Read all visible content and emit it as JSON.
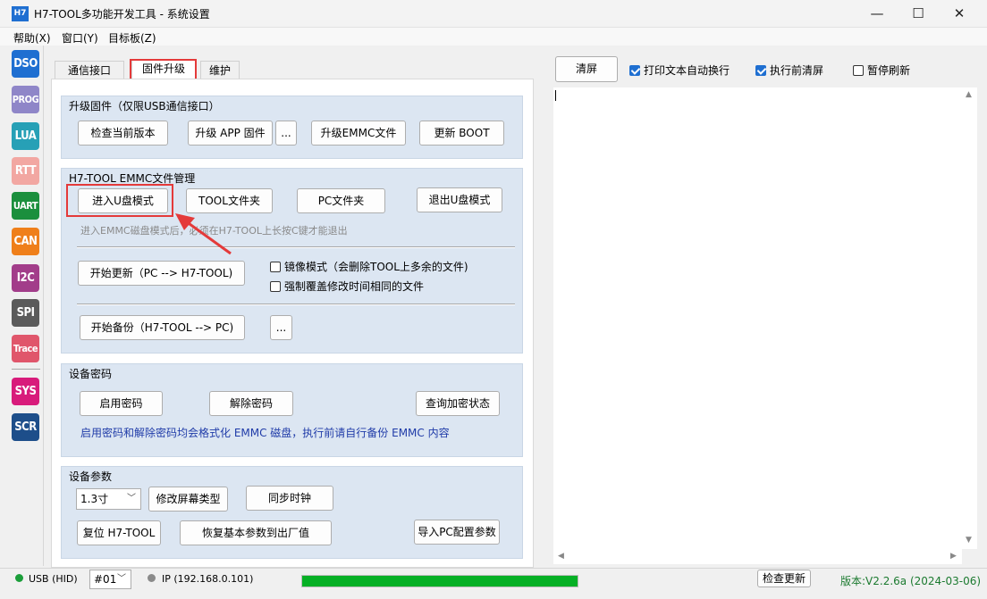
{
  "window": {
    "app_icon": "H7",
    "title": "H7-TOOL多功能开发工具 - 系统设置",
    "minimize": "—",
    "maximize": "☐",
    "close": "✕"
  },
  "menu": [
    "帮助(X)",
    "窗口(Y)",
    "目标板(Z)"
  ],
  "tools": [
    {
      "label": "DSO",
      "color": "#1f6fd1"
    },
    {
      "label": "PROG",
      "color": "#8f86c8"
    },
    {
      "label": "LUA",
      "color": "#27a0b6"
    },
    {
      "label": "RTT",
      "color": "#f2a7a2"
    },
    {
      "label": "UART",
      "color": "#1b8f3d"
    },
    {
      "label": "CAN",
      "color": "#ef7f1a"
    },
    {
      "label": "I2C",
      "color": "#a23d8a"
    },
    {
      "label": "SPI",
      "color": "#5b5b5b"
    },
    {
      "label": "Trace",
      "color": "#e0566b"
    },
    {
      "label": "SYS",
      "color": "#d81b7b"
    },
    {
      "label": "SCR",
      "color": "#1d4e8a"
    }
  ],
  "tabs": [
    "通信接口",
    "固件升级",
    "维护"
  ],
  "firmware": {
    "title": "升级固件（仅限USB通信接口）",
    "check_version": "检查当前版本",
    "upgrade_app": "升级 APP 固件",
    "more": "...",
    "upgrade_emmc": "升级EMMC文件",
    "update_boot": "更新 BOOT"
  },
  "emmc": {
    "title": "H7-TOOL EMMC文件管理",
    "enter_udisk": "进入U盘模式",
    "tool_folder": "TOOL文件夹",
    "pc_folder": "PC文件夹",
    "exit_udisk": "退出U盘模式",
    "hint": "进入EMMC磁盘模式后，必须在H7-TOOL上长按C键才能退出",
    "start_update": "开始更新（PC --> H7-TOOL)",
    "mirror_mode": "镜像模式（会删除TOOL上多余的文件)",
    "force_overwrite": "强制覆盖修改时间相同的文件",
    "start_backup": "开始备份（H7-TOOL --> PC)",
    "more": "..."
  },
  "password": {
    "title": "设备密码",
    "enable": "启用密码",
    "disable": "解除密码",
    "query": "查询加密状态",
    "note": "启用密码和解除密码均会格式化 EMMC 磁盘，执行前请自行备份 EMMC 内容"
  },
  "params": {
    "title": "设备参数",
    "screen_size": "1.3寸",
    "change_screen": "修改屏幕类型",
    "sync_clock": "同步时钟",
    "reset": "复位 H7-TOOL",
    "restore": "恢复基本参数到出厂值",
    "import_pc": "导入PC配置参数"
  },
  "right": {
    "clear": "清屏",
    "auto_wrap": "打印文本自动换行",
    "auto_wrap_checked": true,
    "clear_before": "执行前清屏",
    "clear_before_checked": true,
    "pause_refresh": "暂停刷新",
    "pause_refresh_checked": false
  },
  "status": {
    "usb": "USB (HID)",
    "port": "#01",
    "ip": "IP (192.168.0.101)",
    "progress": 1.0,
    "check_update": "检查更新",
    "version": "版本:V2.2.6a (2024-03-06)"
  }
}
